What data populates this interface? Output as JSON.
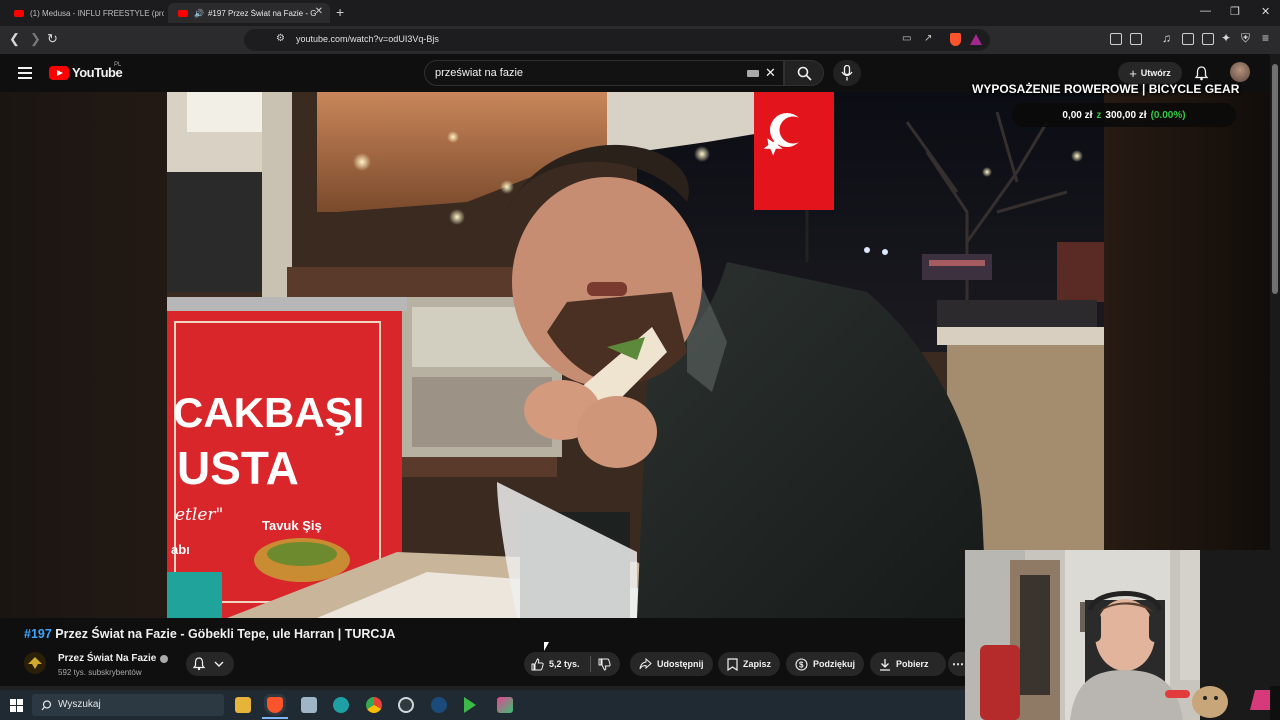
{
  "browser": {
    "tabs": [
      {
        "label": "(1) Medusa - INFLU FREESTYLE (prod"
      },
      {
        "label": "#197 Przez Świat na Fazie - G"
      }
    ],
    "url": "youtube.com/watch?v=odUI3Vq-Bjs"
  },
  "youtube": {
    "logo_text": "YouTube",
    "region": "PL",
    "search_value": "przeświat na fazie",
    "create_label": "Utwórz"
  },
  "overlay": {
    "goal_title": "WYPOSAŻENIE ROWEROWE | BICYCLE GEAR",
    "goal_current": "0,00 zł",
    "goal_connector": "z",
    "goal_target": "300,00 zł",
    "goal_percent": "(0.00%)",
    "goal_progress": 0.0
  },
  "video": {
    "title_number": "#197",
    "title_rest": " Przez Świat na Fazie - Göbekli Tepe, ule Harran | TURCJA",
    "sign_text_1": "CAKBAŞI",
    "sign_text_2": "USTA",
    "sign_text_3": "etler\"",
    "sign_text_4": "Tavuk Şiş",
    "sign_text_5": "abı"
  },
  "channel": {
    "name": "Przez Świat Na Fazie",
    "subscribers": "592 tys. subskrybentów"
  },
  "actions": {
    "likes": "5,2 tys.",
    "share": "Udostępnij",
    "save": "Zapisz",
    "thanks": "Podziękuj",
    "download": "Pobierz"
  },
  "taskbar": {
    "search_placeholder": "Wyszukaj"
  },
  "colors": {
    "youtube_red": "#ff0000",
    "link_blue": "#3ea6ff",
    "goal_green": "#2ecc40",
    "background": "#0f0f0f"
  }
}
